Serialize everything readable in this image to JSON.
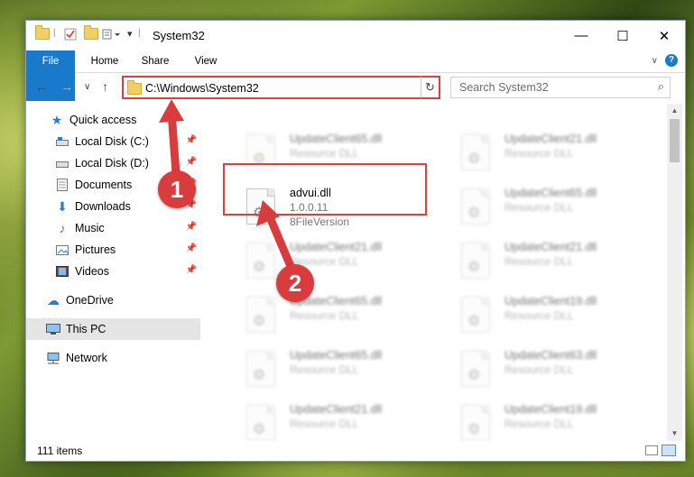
{
  "window": {
    "title": "System32"
  },
  "ribbon": {
    "file": "File",
    "home": "Home",
    "share": "Share",
    "view": "View"
  },
  "address": {
    "path": "C:\\Windows\\System32"
  },
  "search": {
    "placeholder": "Search System32"
  },
  "sidebar": {
    "items": [
      {
        "label": "Quick access"
      },
      {
        "label": "Local Disk (C:)"
      },
      {
        "label": "Local Disk (D:)"
      },
      {
        "label": "Documents"
      },
      {
        "label": "Downloads"
      },
      {
        "label": "Music"
      },
      {
        "label": "Pictures"
      },
      {
        "label": "Videos"
      },
      {
        "label": "OneDrive"
      },
      {
        "label": "This PC"
      },
      {
        "label": "Network"
      }
    ]
  },
  "files": {
    "focused": {
      "name": "advui.dll",
      "version": "1.0.0.11",
      "type": "8FileVersion"
    },
    "left_col": [
      {
        "name": "UpdateClient65.dll",
        "type": "Resource DLL"
      },
      {
        "name": "UpdateClient21.dll",
        "type": "Resource DLL"
      },
      {
        "name": "UpdateClient65.dll",
        "type": "Resource DLL"
      },
      {
        "name": "UpdateClient65.dll",
        "type": "Resource DLL"
      },
      {
        "name": "UpdateClient21.dll",
        "type": "Resource DLL"
      }
    ],
    "right_col": [
      {
        "name": "UpdateClient21.dll",
        "type": "Resource DLL"
      },
      {
        "name": "UpdateClient65.dll",
        "type": "Resource DLL"
      },
      {
        "name": "UpdateClient21.dll",
        "type": "Resource DLL"
      },
      {
        "name": "UpdateClient19.dll",
        "type": "Resource DLL"
      },
      {
        "name": "UpdateClient63.dll",
        "type": "Resource DLL"
      },
      {
        "name": "UpdateClient19.dll",
        "type": "Resource DLL"
      }
    ]
  },
  "status": {
    "count": "111 items"
  },
  "annotations": {
    "step1": "1",
    "step2": "2"
  },
  "colors": {
    "accent": "#1979ca",
    "highlight": "#d94040"
  }
}
